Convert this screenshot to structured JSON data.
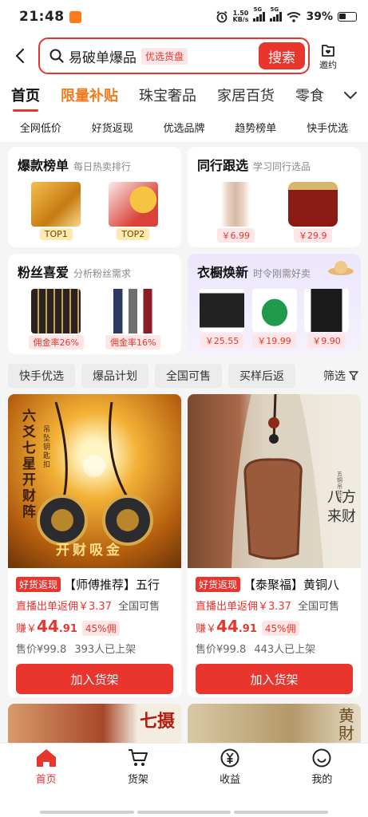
{
  "status": {
    "time": "21:48",
    "speed": "1.50",
    "speed_unit": "KB/s",
    "net1": "5G",
    "net2": "5G",
    "battery": "39%"
  },
  "search": {
    "query": "易破单爆品",
    "tag": "优选货盘",
    "button": "搜索",
    "invite": "邀约"
  },
  "tabs": [
    "首页",
    "限量补贴",
    "珠宝奢品",
    "家居百货",
    "零食"
  ],
  "subtabs": [
    "全网低价",
    "好货返现",
    "优选品牌",
    "趋势榜单",
    "快手优选"
  ],
  "features": {
    "hot": {
      "title": "爆款榜单",
      "sub": "每日热卖排行",
      "tags": [
        "TOP1",
        "TOP2"
      ]
    },
    "peer": {
      "title": "同行跟选",
      "sub": "学习同行选品",
      "prices": [
        "￥6.99",
        "￥29.9"
      ]
    },
    "fans": {
      "title": "粉丝喜爱",
      "sub": "分析粉丝需求",
      "tags": [
        "佣金率26%",
        "佣金率16%"
      ]
    },
    "wardrobe": {
      "title": "衣橱焕新",
      "sub": "时令刚需好卖",
      "prices": [
        "￥25.55",
        "￥19.99",
        "￥9.90"
      ]
    }
  },
  "chips": [
    "快手优选",
    "爆品计划",
    "全国可售",
    "买样后返"
  ],
  "filter": "筛选",
  "products": [
    {
      "badge": "好货返现",
      "title": "【师傅推荐】五行",
      "rebate": "直播出单返佣￥3.37",
      "area": "全国可售",
      "earn_prefix": "赚￥",
      "earn_int": "44",
      "earn_dec": ".91",
      "rate": "45%佣",
      "price": "售价¥99.8",
      "shelf": "393人已上架",
      "button": "加入货架",
      "img_text_top": "六爻七星开财阵",
      "img_text_side": "吊坠钥匙扣",
      "img_text_bottom": "开财吸金"
    },
    {
      "badge": "好货返现",
      "title": "【泰聚福】黄铜八",
      "rebate": "直播出单返佣￥3.37",
      "area": "全国可售",
      "earn_prefix": "赚￥",
      "earn_int": "44",
      "earn_dec": ".91",
      "rate": "45%佣",
      "price": "售价¥99.8",
      "shelf": "443人已上架",
      "button": "加入货架",
      "img_text_side": "五铜吊挂件",
      "img_text_main": "八方来财"
    }
  ],
  "peek": {
    "left_text": "七摄",
    "right_text": "黄財"
  },
  "nav": [
    "首页",
    "货架",
    "收益",
    "我的"
  ],
  "colors": {
    "accent": "#e8352e",
    "hot_tab": "#f07b1d"
  }
}
